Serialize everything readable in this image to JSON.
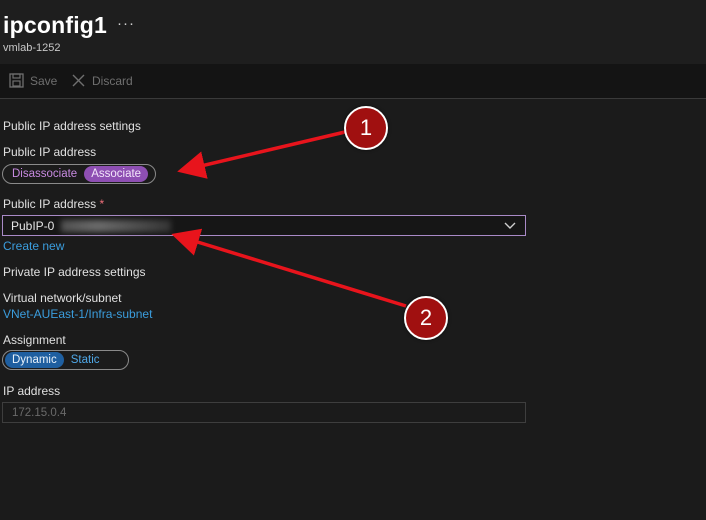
{
  "header": {
    "title": "ipconfig1",
    "more": "···",
    "subtitle": "vmlab-1252"
  },
  "toolbar": {
    "save_label": "Save",
    "discard_label": "Discard"
  },
  "public_ip": {
    "section_title": "Public IP address settings",
    "toggle_label": "Public IP address",
    "toggle_options": [
      "Disassociate",
      "Associate"
    ],
    "toggle_selected": "Associate",
    "dropdown_label": "Public IP address",
    "required_mark": "*",
    "dropdown_value": "PubIP-0",
    "create_new": "Create new"
  },
  "private_ip": {
    "section_title": "Private IP address settings",
    "vnet_label": "Virtual network/subnet",
    "vnet_value": "VNet-AUEast-1/Infra-subnet",
    "assignment_label": "Assignment",
    "assignment_options": [
      "Dynamic",
      "Static"
    ],
    "assignment_selected": "Dynamic",
    "ip_label": "IP address",
    "ip_value": "172.15.0.4"
  },
  "annotations": {
    "marker1": "1",
    "marker2": "2"
  },
  "colors": {
    "accent_purple": "#8e4fb3",
    "link_blue": "#3b9ddd",
    "selected_blue": "#1f5fa0",
    "annotation_red": "#a01010"
  }
}
